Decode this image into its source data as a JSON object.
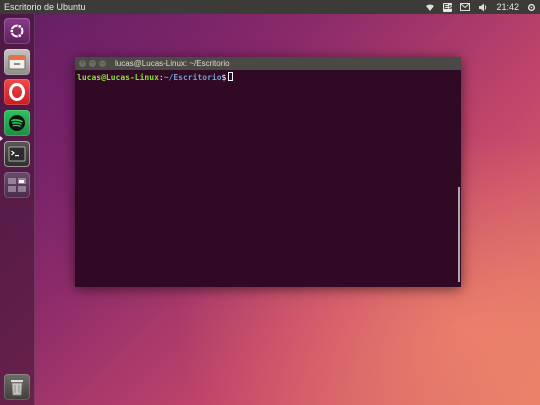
{
  "top_panel": {
    "title": "Escritorio de Ubuntu",
    "keyboard_indicator": "Es",
    "clock": "21:42"
  },
  "launcher": {
    "items": [
      {
        "name": "dash-home",
        "icon": "ubuntu-logo-icon"
      },
      {
        "name": "files",
        "icon": "files-icon"
      },
      {
        "name": "opera",
        "icon": "opera-icon"
      },
      {
        "name": "spotify",
        "icon": "spotify-icon"
      },
      {
        "name": "terminal",
        "icon": "terminal-icon"
      },
      {
        "name": "workspace-switcher",
        "icon": "workspace-icon"
      },
      {
        "name": "trash",
        "icon": "trash-icon"
      }
    ]
  },
  "terminal": {
    "title": "lucas@Lucas-Linux: ~/Escritorio",
    "prompt_user": "lucas@Lucas-Linux",
    "prompt_sep": ":",
    "prompt_path": "~/Escritorio",
    "prompt_symbol": "$"
  },
  "colors": {
    "panel": "#3c3b37",
    "terminal_bg": "#300a24",
    "prompt_user": "#8ae234",
    "prompt_path": "#729fcf"
  }
}
